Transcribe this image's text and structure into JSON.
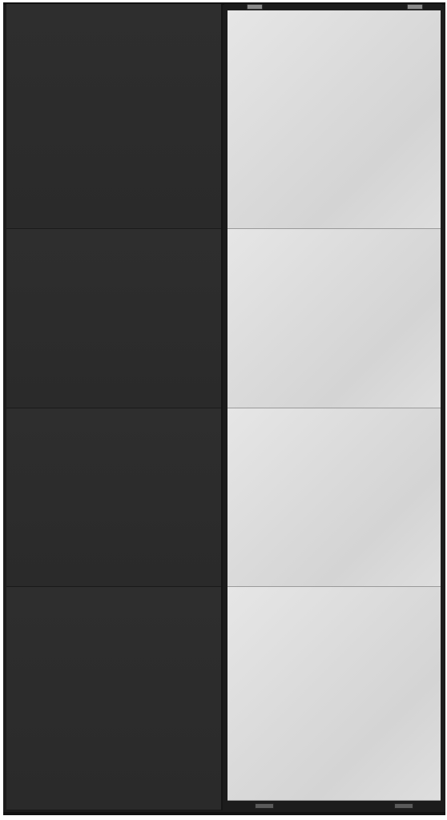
{
  "image": {
    "subject": "wardrobe-with-sliding-doors",
    "colors": {
      "left_door": "#2b2b2b",
      "frame": "#1c1c1c",
      "mirror": "#d9d9d9",
      "mirror_seam": "#9a9a9a",
      "background": "#ffffff"
    },
    "left_door_panel_count": 4,
    "mirror_panel_count": 4
  }
}
